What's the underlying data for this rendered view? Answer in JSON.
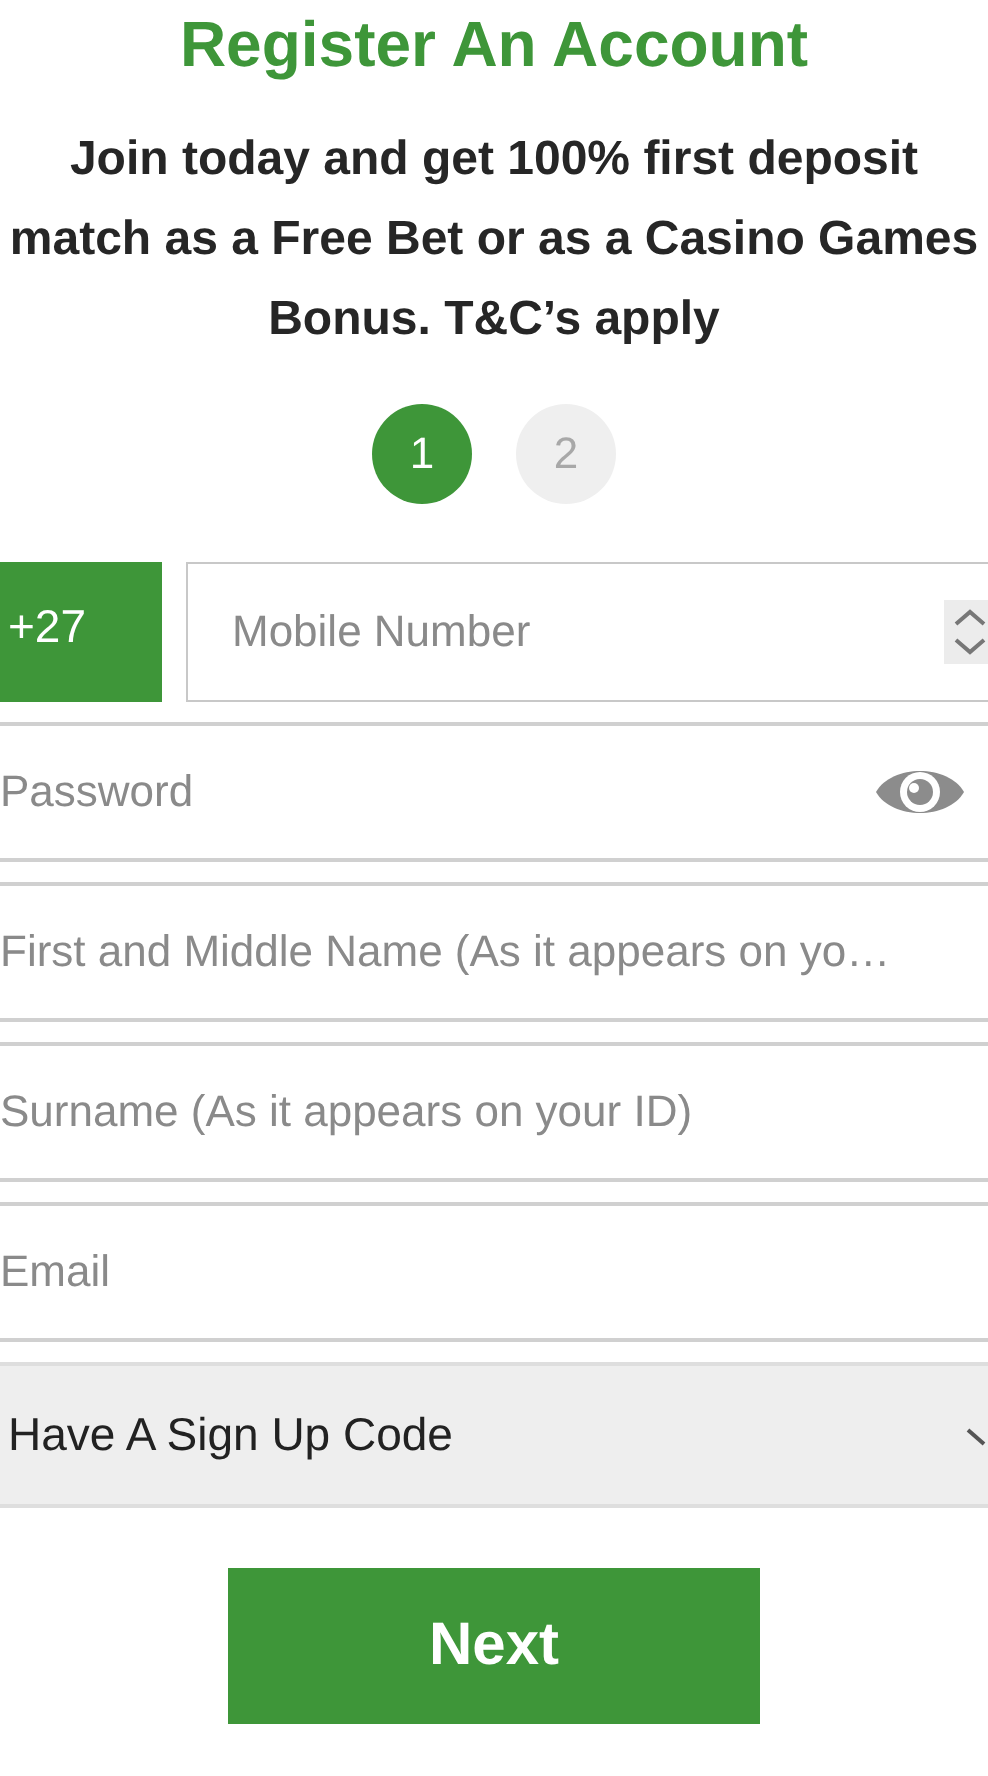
{
  "title": "Register An Account",
  "intro": "Join today and get 100% first deposit match as a Free Bet or as a Casino Games Bonus. T&C’s apply",
  "steps": [
    {
      "label": "1",
      "selected": true
    },
    {
      "label": "2",
      "selected": false
    }
  ],
  "phone": {
    "country_code": "+27",
    "placeholder": "Mobile Number"
  },
  "fields": [
    {
      "kind": "password",
      "placeholder": "Password"
    },
    {
      "kind": "text",
      "placeholder": "First and Middle Name (As it appears on yo…"
    },
    {
      "kind": "text",
      "placeholder": "Surname (As it appears on your ID)"
    },
    {
      "kind": "text",
      "placeholder": "Email"
    }
  ],
  "signup_code": {
    "label": "Have A Sign Up Code",
    "expanded": false
  },
  "next_button": "Next"
}
